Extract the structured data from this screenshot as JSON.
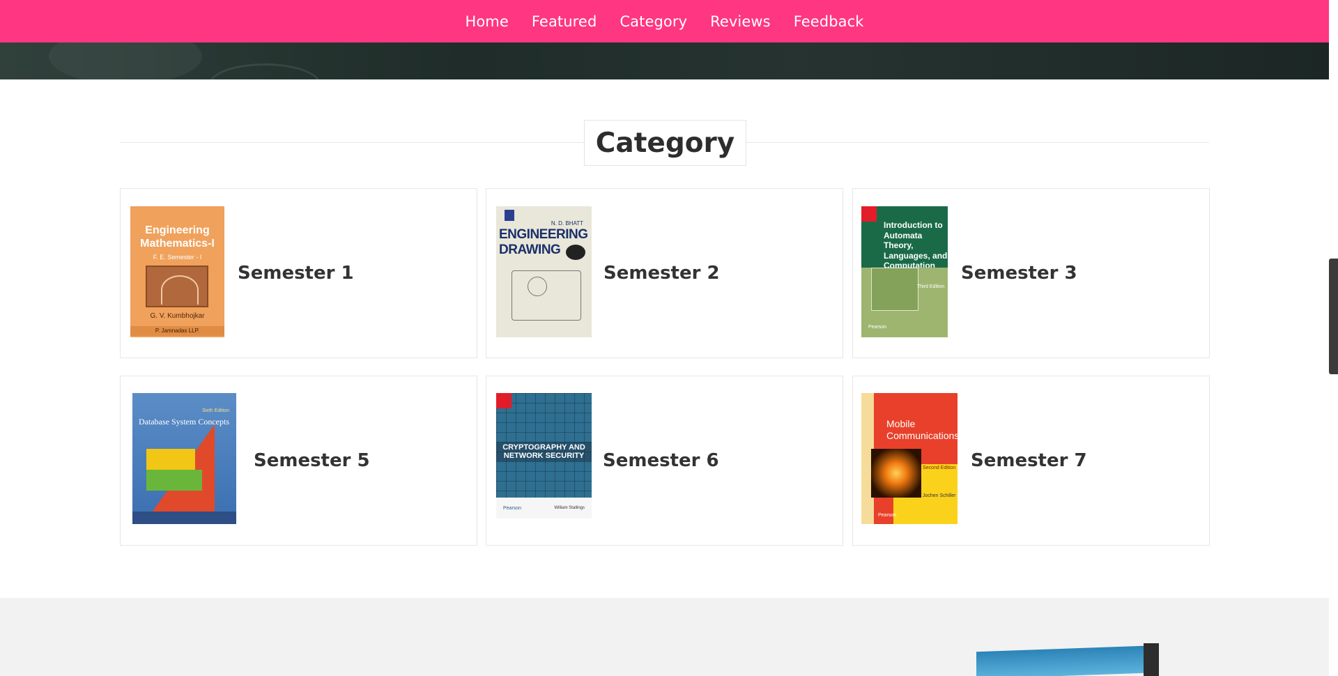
{
  "nav": {
    "items": [
      "Home",
      "Featured",
      "Category",
      "Reviews",
      "Feedback"
    ]
  },
  "category_section": {
    "title": "Category",
    "cards": [
      {
        "label": "Semester 1",
        "cover": {
          "title": "Engineering Mathematics-I",
          "subtitle": "F. E. Semester - I",
          "author": "G. V. Kumbhojkar",
          "publisher": "P. Jamnadas LLP."
        }
      },
      {
        "label": "Semester 2",
        "cover": {
          "title": "ENGINEERING DRAWING",
          "author": "N. D. BHATT"
        }
      },
      {
        "label": "Semester 3",
        "cover": {
          "title": "Introduction to Automata Theory, Languages, and Computation",
          "edition": "Third Edition",
          "publisher": "Pearson"
        }
      },
      {
        "label": "Semester 5",
        "cover": {
          "title": "Database System Concepts",
          "edition": "Sixth Edition"
        }
      },
      {
        "label": "Semester 6",
        "cover": {
          "title": "CRYPTOGRAPHY AND NETWORK SECURITY",
          "publisher": "Pearson",
          "author": "William Stallings"
        }
      },
      {
        "label": "Semester 7",
        "cover": {
          "title": "Mobile Communications",
          "edition": "Second Edition",
          "author": "Jochen Schiller",
          "publisher": "Pearson"
        }
      }
    ]
  },
  "colors": {
    "nav_bg": "#ff3681",
    "heading": "#2d2d2d",
    "card_border": "#e6e6e6"
  }
}
